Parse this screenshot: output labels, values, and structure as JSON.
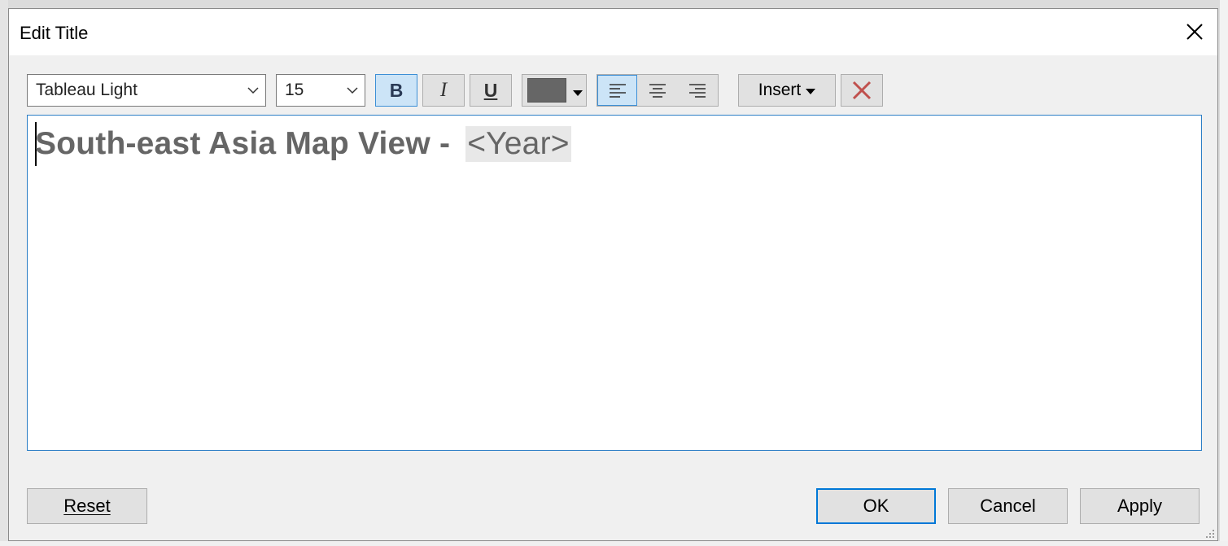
{
  "dialog": {
    "title": "Edit Title"
  },
  "toolbar": {
    "font": "Tableau Light",
    "size": "15",
    "bold_label": "B",
    "italic_label": "I",
    "underline_label": "U",
    "text_color": "#666666",
    "insert_label": "Insert",
    "bold_active": true,
    "alignment": "left"
  },
  "editor": {
    "text": "South-east Asia Map View - ",
    "field": "<Year>"
  },
  "buttons": {
    "reset": "Reset",
    "ok": "OK",
    "cancel": "Cancel",
    "apply": "Apply"
  },
  "colors": {
    "accent": "#0078d7",
    "active_bg": "#cce4f7",
    "clear_icon": "#c0504d"
  }
}
